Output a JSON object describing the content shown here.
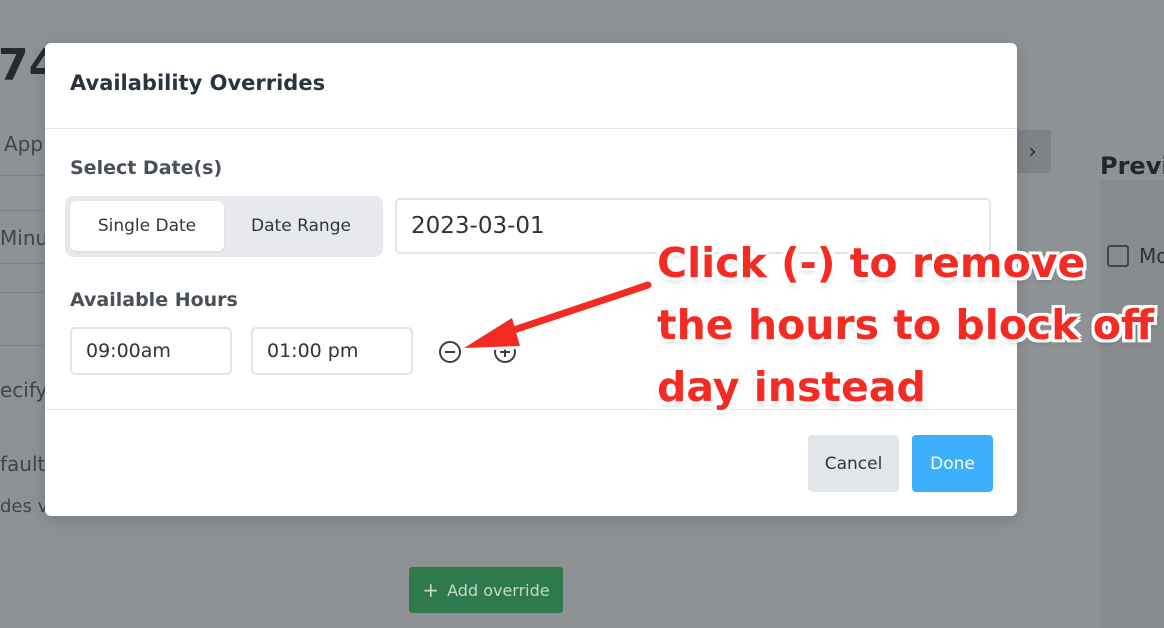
{
  "background": {
    "partial_number": "74",
    "left_texts": [
      "App",
      "Minut",
      "ecify",
      "fault",
      "des v"
    ],
    "nav_arrow": "›",
    "preview_title": "Previ",
    "checkbox_label": "Mo",
    "add_override_label": "Add override"
  },
  "modal": {
    "title": "Availability Overrides",
    "select_dates_label": "Select Date(s)",
    "tabs": [
      {
        "label": "Single Date",
        "active": true
      },
      {
        "label": "Date Range",
        "active": false
      }
    ],
    "date_value": "2023-03-01",
    "available_hours_label": "Available Hours",
    "start_time": "09:00am",
    "end_time": "01:00 pm",
    "cancel_label": "Cancel",
    "done_label": "Done"
  },
  "annotation": {
    "lines": [
      "Click (-) to remove",
      "the hours to block off",
      "day instead"
    ],
    "color": "#f32b22"
  },
  "colors": {
    "primary": "#3cb0fb",
    "success": "#2f7a4d",
    "overlay": "#8e9295"
  }
}
